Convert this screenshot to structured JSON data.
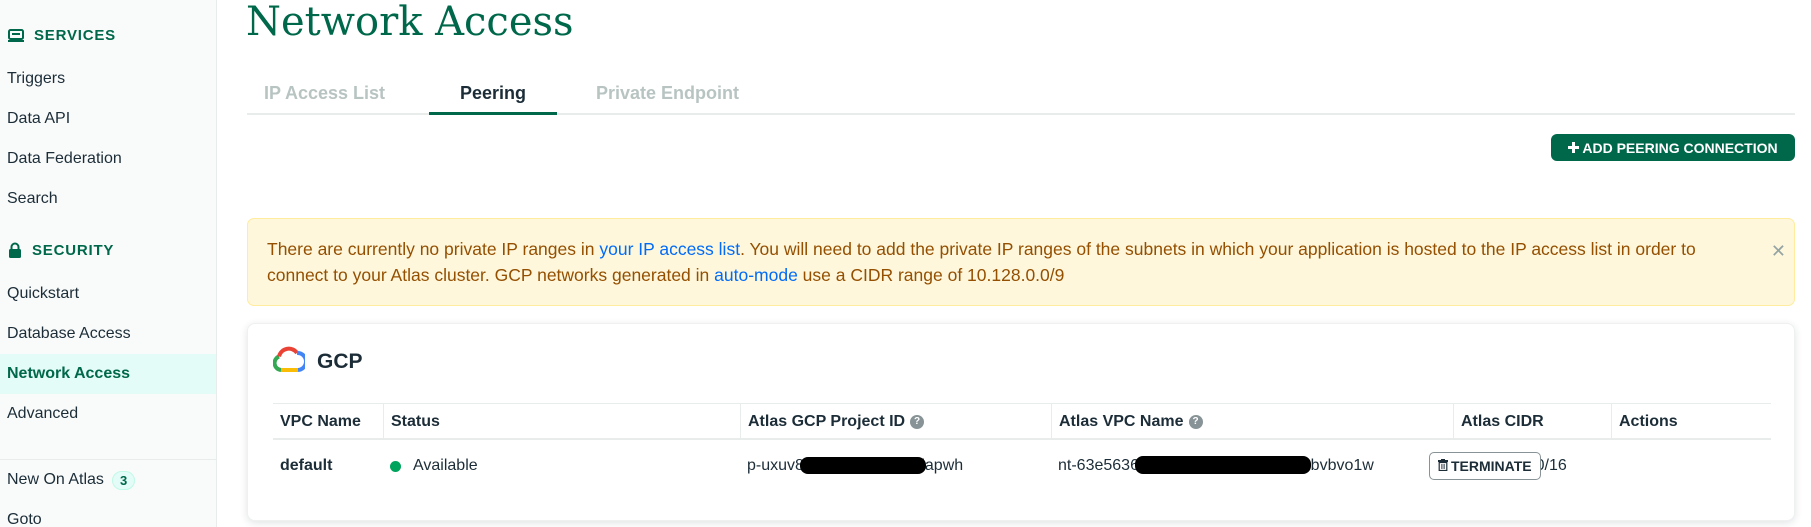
{
  "sidebar": {
    "services_heading": "SERVICES",
    "services_items": [
      "Triggers",
      "Data API",
      "Data Federation",
      "Search"
    ],
    "security_heading": "SECURITY",
    "security_items": [
      "Quickstart",
      "Database Access",
      "Network Access",
      "Advanced"
    ],
    "active_item": "Network Access",
    "footer_items": {
      "new_on_atlas": "New On Atlas",
      "new_on_atlas_count": "3",
      "goto": "Goto"
    }
  },
  "page": {
    "title": "Network Access",
    "tabs": [
      "IP Access List",
      "Peering",
      "Private Endpoint"
    ],
    "active_tab": "Peering",
    "add_button_label": "ADD PEERING CONNECTION"
  },
  "banner": {
    "text_1": "There are currently no private IP ranges in ",
    "link_1": "your IP access list",
    "text_2": ". You will need to add the private IP ranges of the subnets in which your application is hosted to the IP access list in order to connect to your Atlas cluster. GCP networks generated in ",
    "link_2": "auto-mode",
    "text_3": " use a CIDR range of 10.128.0.0/9"
  },
  "provider": {
    "name": "GCP",
    "columns": [
      "VPC Name",
      "Status",
      "Atlas GCP Project ID",
      "Atlas VPC Name",
      "Atlas CIDR",
      "Actions"
    ],
    "rows": [
      {
        "vpc_name": "default",
        "status": "Available",
        "project_id": "p-uxuv8ulc7f7d5m4ngs8iapwh",
        "vpc": "nt-63e5636b0f2a7e4c1d9e0b1ec6ebvbvo1w",
        "cidr": "192.168.0.0/16",
        "action_label": "TERMINATE"
      }
    ]
  },
  "colors": {
    "brand_green": "#00684a",
    "status_available": "#00a35c",
    "banner_bg": "#fef7db",
    "banner_text": "#944f01",
    "link": "#016bf8"
  },
  "icons": {
    "services": "server-icon",
    "security": "lock-icon",
    "add": "plus-icon",
    "close": "close-icon",
    "gcp": "gcp-cloud-icon",
    "help": "help-circle-icon",
    "terminate": "trash-icon"
  }
}
